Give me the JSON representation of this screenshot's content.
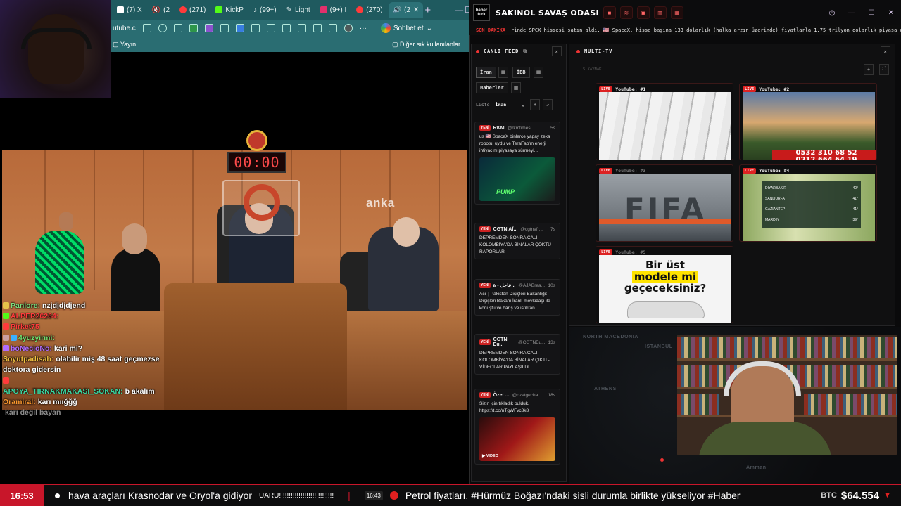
{
  "browser": {
    "tabs": [
      {
        "label": "(7) X",
        "color": "#ffffff"
      },
      {
        "label": "(2",
        "color": "#ff3b3b"
      },
      {
        "label": "(271)",
        "color": "#ff3b3b"
      },
      {
        "label": "KickP",
        "color": "#53fc18"
      },
      {
        "label": "(99+)",
        "color": "#ffffff"
      },
      {
        "label": "Light",
        "color": "#9b8cff"
      },
      {
        "label": "(9+) I",
        "color": "#e1306c"
      },
      {
        "label": "(270)",
        "color": "#ff3b3b"
      },
      {
        "label": "(2",
        "color": "#ff3b3b"
      }
    ],
    "new_tab": "+",
    "window": {
      "minimize": "—",
      "maximize": "☐",
      "close": "✕"
    },
    "address": "utube.c",
    "sohbet_label": "Sohbet et",
    "bookmark_left": "Yayın",
    "bookmark_right": "Diğer sık kullanılanlar"
  },
  "video": {
    "watermark": "anka",
    "timer": "00:00"
  },
  "chat": [
    {
      "user": "Panlore:",
      "msg": "nzjdjdjdjend",
      "color": "#7ee07e"
    },
    {
      "user": "ALPER26264:",
      "msg": "",
      "color": "#ff3b3b"
    },
    {
      "user": "Pirket75",
      "msg": "",
      "color": "#ff3b3b"
    },
    {
      "user": "4yuzyirmi:",
      "msg": "",
      "color": "#6fe06f"
    },
    {
      "user": "boNecioNo:",
      "msg": "kari mi?",
      "color": "#b06cff"
    },
    {
      "user": "Soyutpadisah:",
      "msg": "olabilir miş 48 saat geçmezse doktora gidersin",
      "color": "#f0c040"
    },
    {
      "user": "",
      "msg": "",
      "color": "#ff3b3b"
    },
    {
      "user": "APOYA_TIRNAKMAKASI_SOKAN:",
      "msg": "b akalım",
      "color": "#3ad6a0"
    },
    {
      "user": "Oramiral:",
      "msg": "karı mıığğğ",
      "color": "#ff9a2e"
    },
    {
      "user": "",
      "msg": "karı değil bayan",
      "color": "#ff3b3b"
    }
  ],
  "dashboard": {
    "logo": "haber turk",
    "title": "SAKINOL SAVAŞ ODASI",
    "header_buttons": [
      "■",
      "≋",
      "▣",
      "▥",
      "▦"
    ],
    "window_controls": [
      "◷",
      "—",
      "☐",
      "✕"
    ],
    "ticker_label": "SON DAKİKA",
    "ticker_text": "rinde SPCX hissesi satın aldı. 🇺🇸 SpaceX, hisse başına 133 dolarlık (halka arzın üzerinde) fiyatlarla 1,75 trilyon dolarlık piyasa değerini geri a"
  },
  "feed": {
    "title": "CANLI FEED",
    "chips": [
      "İran",
      "İBB",
      "Haberler"
    ],
    "liste_label": "Liste:",
    "liste_value": "İran",
    "cards": [
      {
        "badge": "YENİ",
        "source": "RKM",
        "handle": "@rkmtimes",
        "age": "5s",
        "text": "us 🇺🇸 SpaceX binlerce yapay zeka robotu, uydu ve TeraFab'ın enerji ihtiyacını piyasaya sürmeyi...",
        "thumb_text": "PUMP"
      },
      {
        "badge": "YENİ",
        "source": "CGTN Af...",
        "handle": "@cgtnafr...",
        "age": "7s",
        "text": "DEPREMDEN SONRA CALI, KOLOMBİYA'DA BİNALAR ÇÖKTÜ - RAPORLAR"
      },
      {
        "badge": "YENİ",
        "source": "عاجل - ة...",
        "handle": "@AJABrea...",
        "age": "10s",
        "text": "Acil | Pakistan Dışişleri Bakanlığı: Dışişleri Bakanı İranlı mevkidaşı ile konuştu ve barış ve istikran..."
      },
      {
        "badge": "YENİ",
        "source": "CGTN Eu...",
        "handle": "@CGTNEu...",
        "age": "13s",
        "text": "DEPREMDEN SONRA CALI, KOLOMBİYA'DA BİNALAR ÇIKTI - VİDEOLAR PAYLAŞILDI"
      },
      {
        "badge": "YENİ",
        "source": "Özet ...",
        "handle": "@ozetgecha...",
        "age": "18s",
        "text": "Sizin için tıkladık bulduk. https://t.co/nTgWFvc8k8",
        "thumb_text": "▶ VIDEO"
      }
    ]
  },
  "multitv": {
    "title": "MULTI-TV",
    "subtitle": "5 KAYNAK",
    "tiles": [
      {
        "live": "LIVE",
        "label": "YouTube: #1"
      },
      {
        "live": "LIVE",
        "label": "YouTube: #2",
        "phone": "0532 310 68 52\n0212 664 64 19"
      },
      {
        "live": "LIVE",
        "label": "YouTube: #3",
        "overlay": "FIFA"
      },
      {
        "live": "LIVE",
        "label": "YouTube: #4",
        "cities": [
          "DİYARBAKIR",
          "ŞANLIURFA",
          "GAZİANTEP",
          "MARDİN"
        ],
        "temps": [
          "40°",
          "41°",
          "41°",
          "39°"
        ]
      },
      {
        "live": "LIVE",
        "label": "YouTube: #5",
        "ad_line1": "Bir üst",
        "ad_line2": "modele mi",
        "ad_line3": "geçeceksiniz?"
      }
    ]
  },
  "map_labels": [
    "NORTH MACEDONIA",
    "ATHENS",
    "ISTANBUL",
    "Amman"
  ],
  "bottom": {
    "clock": "16:53",
    "headline1": "hava araçları Krasnodar ve Oryol'a gidiyor",
    "headline1_tail": "UARU!!!!!!!!!!!!!!!!!!!!!!!!!!!!",
    "time2": "16:43",
    "headline2": "Petrol fiyatları, #Hürmüz Boğazı'ndaki sisli durumla birlikte yükseliyor #Haber",
    "btc_label": "BTC",
    "btc_value": "$64.554",
    "btc_arrow": "▼"
  }
}
